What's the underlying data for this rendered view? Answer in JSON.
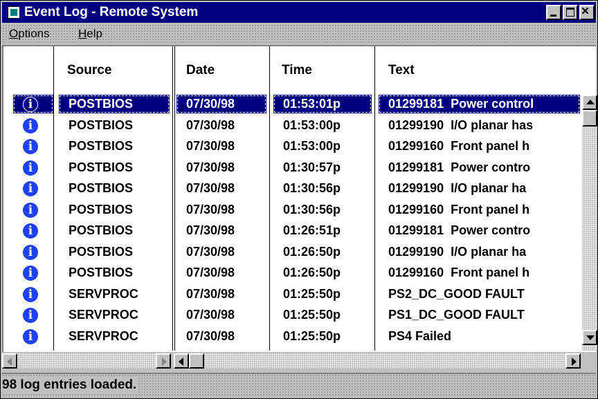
{
  "window": {
    "title": "Event Log - Remote System"
  },
  "menu": {
    "options_label": "Options",
    "help_label": "Help"
  },
  "columns": {
    "source": "Source",
    "date": "Date",
    "time": "Time",
    "text": "Text"
  },
  "rows": [
    {
      "icon": "info-icon",
      "source": "POSTBIOS",
      "date": "07/30/98",
      "time": "01:53:01p",
      "text": "01299181  Power control",
      "selected": true
    },
    {
      "icon": "info-icon",
      "source": "POSTBIOS",
      "date": "07/30/98",
      "time": "01:53:00p",
      "text": "01299190  I/O planar has"
    },
    {
      "icon": "info-icon",
      "source": "POSTBIOS",
      "date": "07/30/98",
      "time": "01:53:00p",
      "text": "01299160  Front panel h"
    },
    {
      "icon": "info-icon",
      "source": "POSTBIOS",
      "date": "07/30/98",
      "time": "01:30:57p",
      "text": "01299181  Power contro"
    },
    {
      "icon": "info-icon",
      "source": "POSTBIOS",
      "date": "07/30/98",
      "time": "01:30:56p",
      "text": "01299190  I/O planar ha"
    },
    {
      "icon": "info-icon",
      "source": "POSTBIOS",
      "date": "07/30/98",
      "time": "01:30:56p",
      "text": "01299160  Front panel h"
    },
    {
      "icon": "info-icon",
      "source": "POSTBIOS",
      "date": "07/30/98",
      "time": "01:26:51p",
      "text": "01299181  Power contro"
    },
    {
      "icon": "info-icon",
      "source": "POSTBIOS",
      "date": "07/30/98",
      "time": "01:26:50p",
      "text": "01299190  I/O planar ha"
    },
    {
      "icon": "info-icon",
      "source": "POSTBIOS",
      "date": "07/30/98",
      "time": "01:26:50p",
      "text": "01299160  Front panel h"
    },
    {
      "icon": "info-icon",
      "source": "SERVPROC",
      "date": "07/30/98",
      "time": "01:25:50p",
      "text": "PS2_DC_GOOD FAULT"
    },
    {
      "icon": "info-icon",
      "source": "SERVPROC",
      "date": "07/30/98",
      "time": "01:25:50p",
      "text": "PS1_DC_GOOD FAULT"
    },
    {
      "icon": "info-icon",
      "source": "SERVPROC",
      "date": "07/30/98",
      "time": "01:25:50p",
      "text": "PS4 Failed"
    }
  ],
  "status": {
    "text": "98 log entries loaded."
  },
  "colors": {
    "titlebar": "#000080",
    "selection": "#000080",
    "info_icon": "#1e40ff"
  }
}
